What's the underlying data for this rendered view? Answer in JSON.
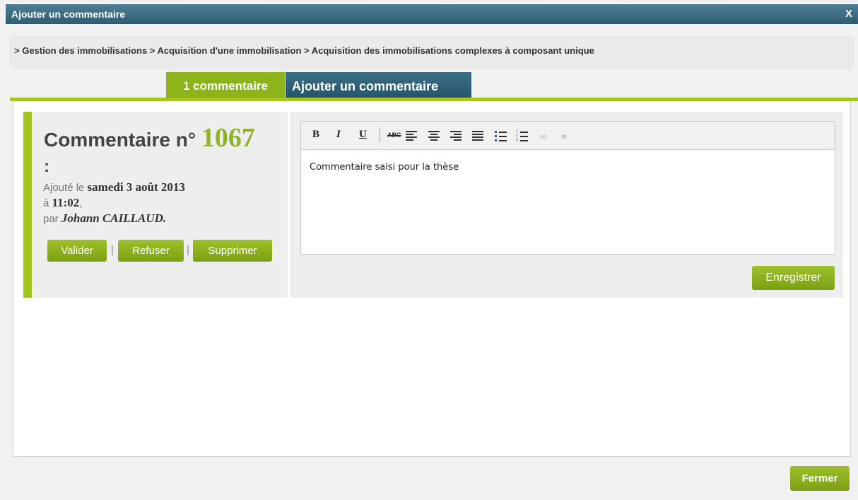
{
  "dialog": {
    "title": "Ajouter un commentaire",
    "close_label": "X"
  },
  "breadcrumb": {
    "text": "> Gestion des immobilisations > Acquisition d'une immobilisation > Acquisition des immobilisations complexes à composant unique"
  },
  "tabs": [
    {
      "label": "1 commentaire",
      "active": true
    },
    {
      "label": "Ajouter un commentaire",
      "active": false
    }
  ],
  "comment": {
    "heading_prefix": "Commentaire n°",
    "number": "1067",
    "colon": ":",
    "added_label": "Ajouté le",
    "date": "samedi 3 août 2013",
    "time_prefix": "à",
    "time": "11:02",
    "time_suffix": ",",
    "by_label": "par",
    "author": "Johann CAILLAUD.",
    "actions": {
      "validate": "Valider",
      "refuse": "Refuser",
      "delete": "Supprimer",
      "separator": "|"
    }
  },
  "editor": {
    "toolbar": {
      "bold": "B",
      "italic": "I",
      "underline": "U",
      "strike": "ABC"
    },
    "content": "Commentaire saisi pour la thèse",
    "save_label": "Enregistrer"
  },
  "footer": {
    "close_label": "Fermer"
  },
  "colors": {
    "accent_green": "#8cb31a",
    "title_blue": "#2e5c73"
  }
}
